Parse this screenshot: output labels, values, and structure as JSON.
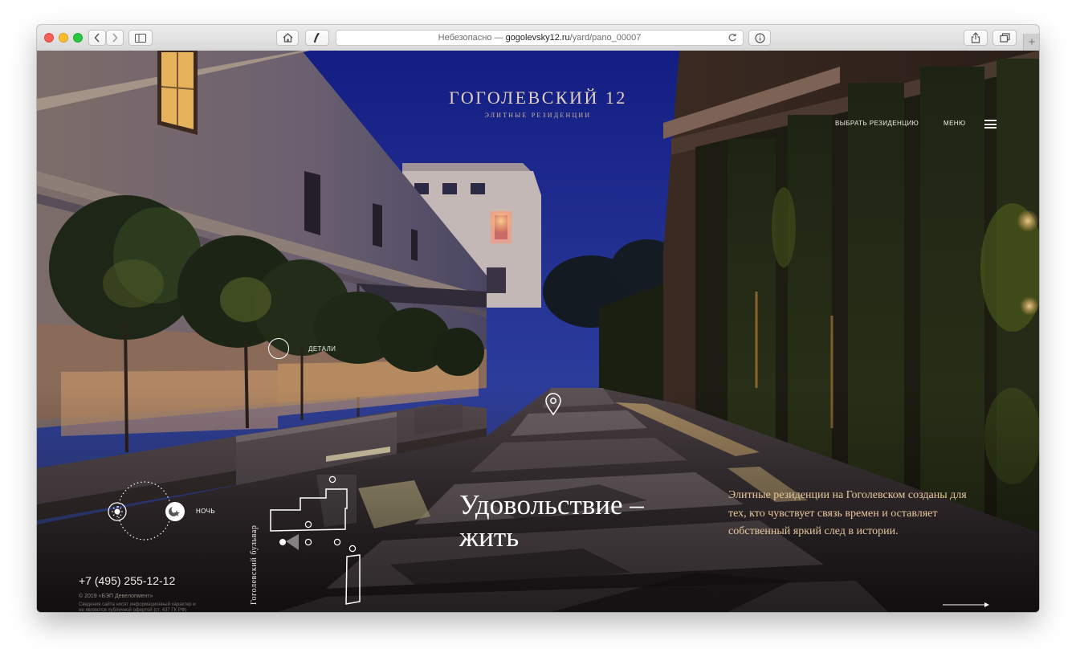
{
  "browser": {
    "url_prefix": "Небезопасно — ",
    "url_domain": "gogolevsky12.ru",
    "url_path": "/yard/pano_00007",
    "new_tab_label": "+"
  },
  "header": {
    "brand_title": "ГОГОЛЕВСКИЙ 12",
    "brand_subtitle": "ЭЛИТНЫЕ РЕЗИДЕНЦИИ",
    "choose_residence": "ВЫБРАТЬ РЕЗИДЕНЦИЮ",
    "menu_label": "МЕНЮ"
  },
  "hotspot": {
    "details_label": "ДЕТАЛИ"
  },
  "mode_switch": {
    "night_label": "НОЧЬ"
  },
  "map": {
    "street_label": "Гоголевский бульвар"
  },
  "hero": {
    "headline_line1": "Удовольствие –",
    "headline_line2": "жить",
    "description": "Элитные резиденции на Гоголевском созданы для тех, кто чувствует связь времен и оставляет собственный яркий след в истории."
  },
  "footer": {
    "phone": "+7 (495) 255-12-12",
    "copyright": "© 2019 «БЭП Девелопмент»",
    "disclaimer": "Сведения сайта носят информационный характер и не являются публичной офертой (ст. 437 ГК РФ)"
  },
  "colors": {
    "accent_gold": "#e8c99c",
    "brand_beige": "#e4d1bd",
    "sky": "#1f2e8c",
    "corner_mark": "#e2462f"
  }
}
